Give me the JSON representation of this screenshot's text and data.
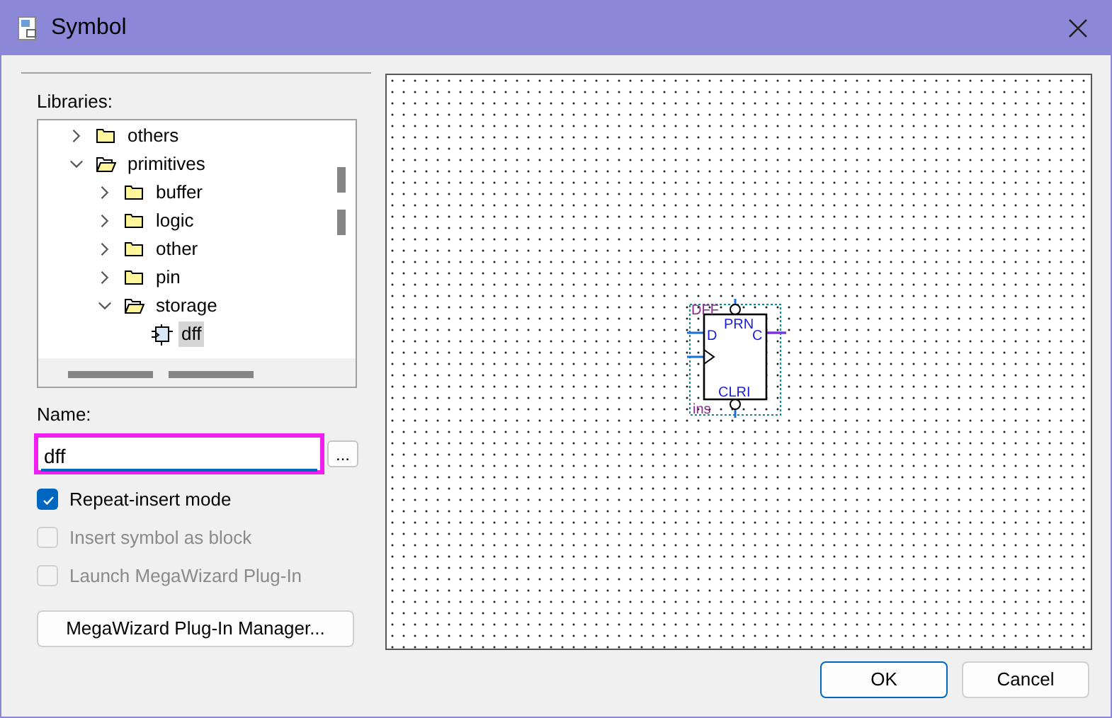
{
  "window": {
    "title": "Symbol"
  },
  "libraries": {
    "label": "Libraries:",
    "tree": [
      {
        "label": "others",
        "kind": "folder",
        "expanded": false,
        "selected": false
      },
      {
        "label": "primitives",
        "kind": "folder",
        "expanded": true,
        "selected": false,
        "children": [
          {
            "label": "buffer",
            "kind": "folder",
            "expanded": false,
            "selected": false
          },
          {
            "label": "logic",
            "kind": "folder",
            "expanded": false,
            "selected": false
          },
          {
            "label": "other",
            "kind": "folder",
            "expanded": false,
            "selected": false
          },
          {
            "label": "pin",
            "kind": "folder",
            "expanded": false,
            "selected": false
          },
          {
            "label": "storage",
            "kind": "folder",
            "expanded": true,
            "selected": false,
            "children": [
              {
                "label": "dff",
                "kind": "symbol",
                "selected": true
              }
            ]
          }
        ]
      }
    ]
  },
  "name": {
    "label": "Name:",
    "value": "dff",
    "browse": "..."
  },
  "options": [
    {
      "label": "Repeat-insert mode",
      "checked": true,
      "disabled": false
    },
    {
      "label": "Insert symbol as block",
      "checked": false,
      "disabled": true
    },
    {
      "label": "Launch MegaWizard Plug-In",
      "checked": false,
      "disabled": true
    }
  ],
  "manager_button": "MegaWizard Plug-In Manager...",
  "preview": {
    "symbol": {
      "type": "DFF",
      "preset": "PRN",
      "d": "D",
      "q": "C",
      "clear": "CLRI",
      "instance": "ins"
    }
  },
  "buttons": [
    "OK",
    "Cancel"
  ]
}
